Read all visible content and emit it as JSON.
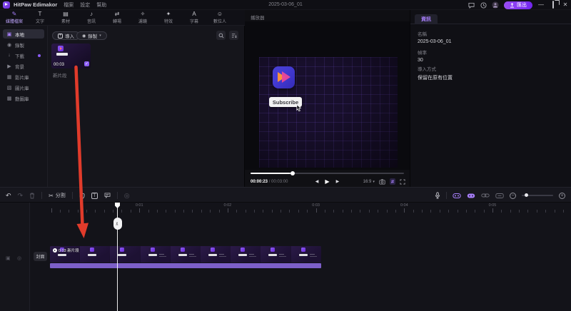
{
  "titlebar": {
    "app_name": "HitPaw Edimakor",
    "menus": [
      "檔案",
      "設定",
      "幫助"
    ],
    "project_title": "2025-03-06_01",
    "export_label": "匯出",
    "minimize_glyph": "—",
    "close_glyph": "✕"
  },
  "ribbon": {
    "tabs": [
      {
        "label": "媒體檔案",
        "glyph": "✎",
        "active": true
      },
      {
        "label": "文字",
        "glyph": "T"
      },
      {
        "label": "素材",
        "glyph": "▤"
      },
      {
        "label": "音訊",
        "glyph": "♪"
      },
      {
        "label": "轉場",
        "glyph": "⇄"
      },
      {
        "label": "濾鏡",
        "glyph": "✧"
      },
      {
        "label": "特效",
        "glyph": "✦"
      },
      {
        "label": "字幕",
        "glyph": "A"
      },
      {
        "label": "數位人",
        "glyph": "☺"
      }
    ]
  },
  "sidebar": {
    "items": [
      {
        "label": "本地",
        "glyph": "▣",
        "active": true
      },
      {
        "label": "錄製",
        "glyph": "◉"
      },
      {
        "label": "下載",
        "glyph": "↓",
        "badge": true
      },
      {
        "label": "背景",
        "glyph": "▶"
      },
      {
        "label": "影片庫",
        "glyph": "▦"
      },
      {
        "label": "圖片庫",
        "glyph": "▧"
      },
      {
        "label": "動圖庫",
        "glyph": "▩"
      }
    ]
  },
  "media_panel": {
    "import_label": "導入",
    "import_glyph": "+",
    "record_label": "錄製",
    "record_glyph": "◉",
    "record_caret": "▾",
    "clip": {
      "duration": "00:03",
      "name": "新片段",
      "check_glyph": "✓"
    }
  },
  "preview": {
    "header": "播放器",
    "video_overlay_text": "Subscribe",
    "time_current": "00:00:23",
    "time_separator": "/",
    "time_total": "00:03:00",
    "transport": {
      "prev": "◀",
      "play": "▶",
      "next": "▶"
    },
    "aspect_ratio": "16:9",
    "aspect_caret": "▾",
    "grid_glyph": "#"
  },
  "info_panel": {
    "tab_label": "資訊",
    "fields": [
      {
        "label": "名稱",
        "value": "2025-03-06_01"
      },
      {
        "label": "幀率",
        "value": "30"
      },
      {
        "label": "導入方式",
        "value": "保留在原有位置"
      }
    ]
  },
  "timeline_toolbar": {
    "undo_glyph": "↶",
    "redo_glyph": "↷",
    "split_glyph": "✂",
    "split_label": "分割"
  },
  "timeline": {
    "cover_label": "封面",
    "clip_label": "0:03 新片段",
    "ruler_labels": [
      "0:01",
      "0:02",
      "0:03",
      "0:04",
      "0:05"
    ]
  }
}
